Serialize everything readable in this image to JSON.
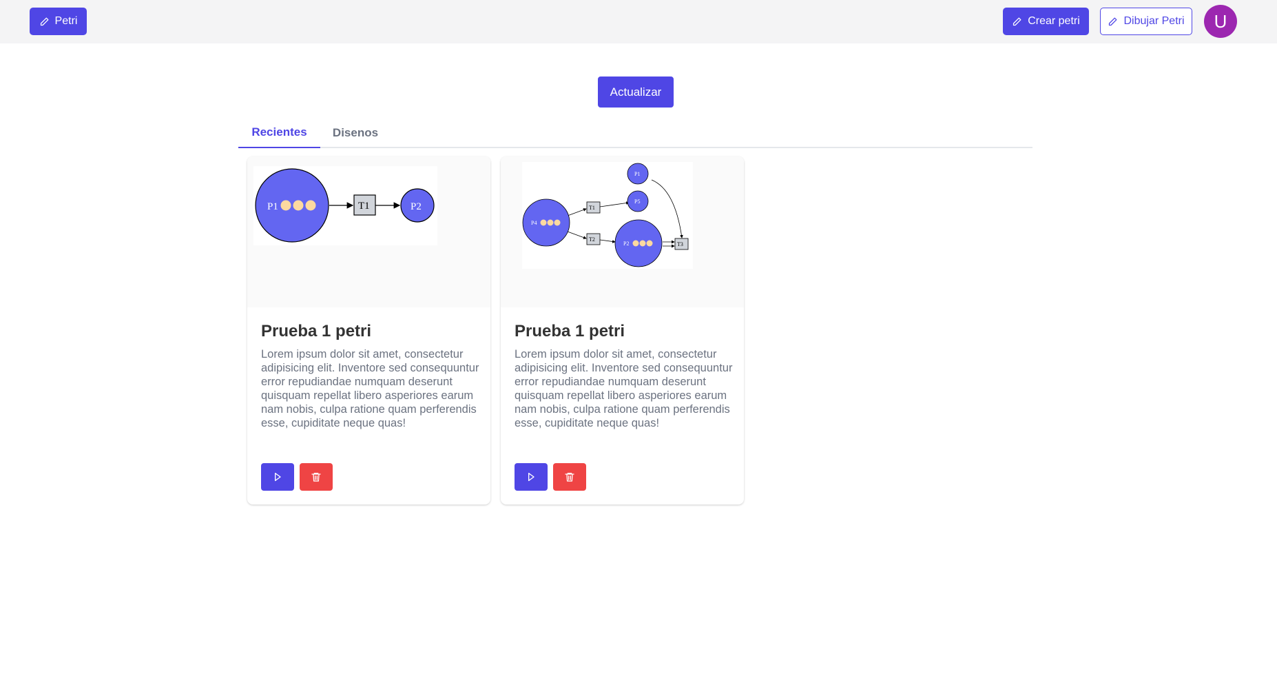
{
  "navbar": {
    "brand_label": "Petri",
    "create_label": "Crear petri",
    "draw_label": "Dibujar Petri",
    "avatar_initial": "U"
  },
  "main": {
    "refresh_label": "Actualizar",
    "tabs": [
      {
        "label": "Recientes",
        "active": true
      },
      {
        "label": "Disenos",
        "active": false
      }
    ],
    "cards": [
      {
        "title": "Prueba 1 petri",
        "description": "Lorem ipsum dolor sit amet, consectetur adipisicing elit. Inventore sed consequuntur error repudiandae numquam deserunt quisquam repellat libero asperiores earum nam nobis, culpa ratione quam perferendis esse, cupiditate neque quas!",
        "diagram": {
          "places": [
            "P1",
            "P2"
          ],
          "transitions": [
            "T1"
          ],
          "tokens": {
            "P1": 3
          }
        }
      },
      {
        "title": "Prueba 1 petri",
        "description": "Lorem ipsum dolor sit amet, consectetur adipisicing elit. Inventore sed consequuntur error repudiandae numquam deserunt quisquam repellat libero asperiores earum nam nobis, culpa ratione quam perferendis esse, cupiditate neque quas!",
        "diagram": {
          "places": [
            "P1",
            "P5",
            "P4",
            "P2"
          ],
          "transitions": [
            "T1",
            "T2",
            "T3"
          ],
          "tokens": {
            "P4": 3,
            "P2": 3
          }
        }
      }
    ]
  },
  "colors": {
    "primary": "#4f46e5",
    "danger": "#ef4444",
    "avatar": "#9c27b0",
    "place_fill": "#6366f1",
    "token": "#fcd9a0",
    "transition_fill": "#d1d5db",
    "navbar_bg": "#f4f4f5"
  },
  "icons": {
    "brand": "pencil-icon",
    "create": "pencil-icon",
    "draw": "pencil-icon",
    "play": "play-icon",
    "delete": "trash-icon"
  }
}
